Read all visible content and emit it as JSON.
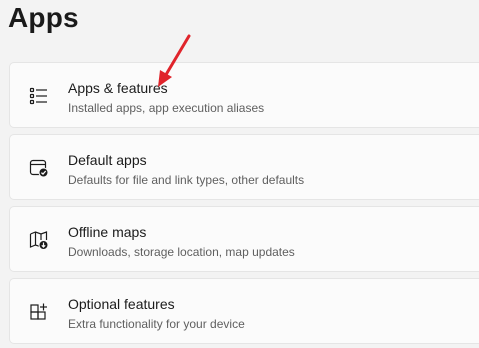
{
  "page": {
    "title": "Apps"
  },
  "items": [
    {
      "title": "Apps & features",
      "subtitle": "Installed apps, app execution aliases",
      "icon": "apps-list-icon"
    },
    {
      "title": "Default apps",
      "subtitle": "Defaults for file and link types, other defaults",
      "icon": "default-apps-icon"
    },
    {
      "title": "Offline maps",
      "subtitle": "Downloads, storage location, map updates",
      "icon": "offline-maps-icon"
    },
    {
      "title": "Optional features",
      "subtitle": "Extra functionality for your device",
      "icon": "optional-features-icon"
    }
  ],
  "colors": {
    "annotation_arrow": "#e0242b",
    "card_bg": "#fbfbfb",
    "page_bg": "#f3f3f3"
  }
}
